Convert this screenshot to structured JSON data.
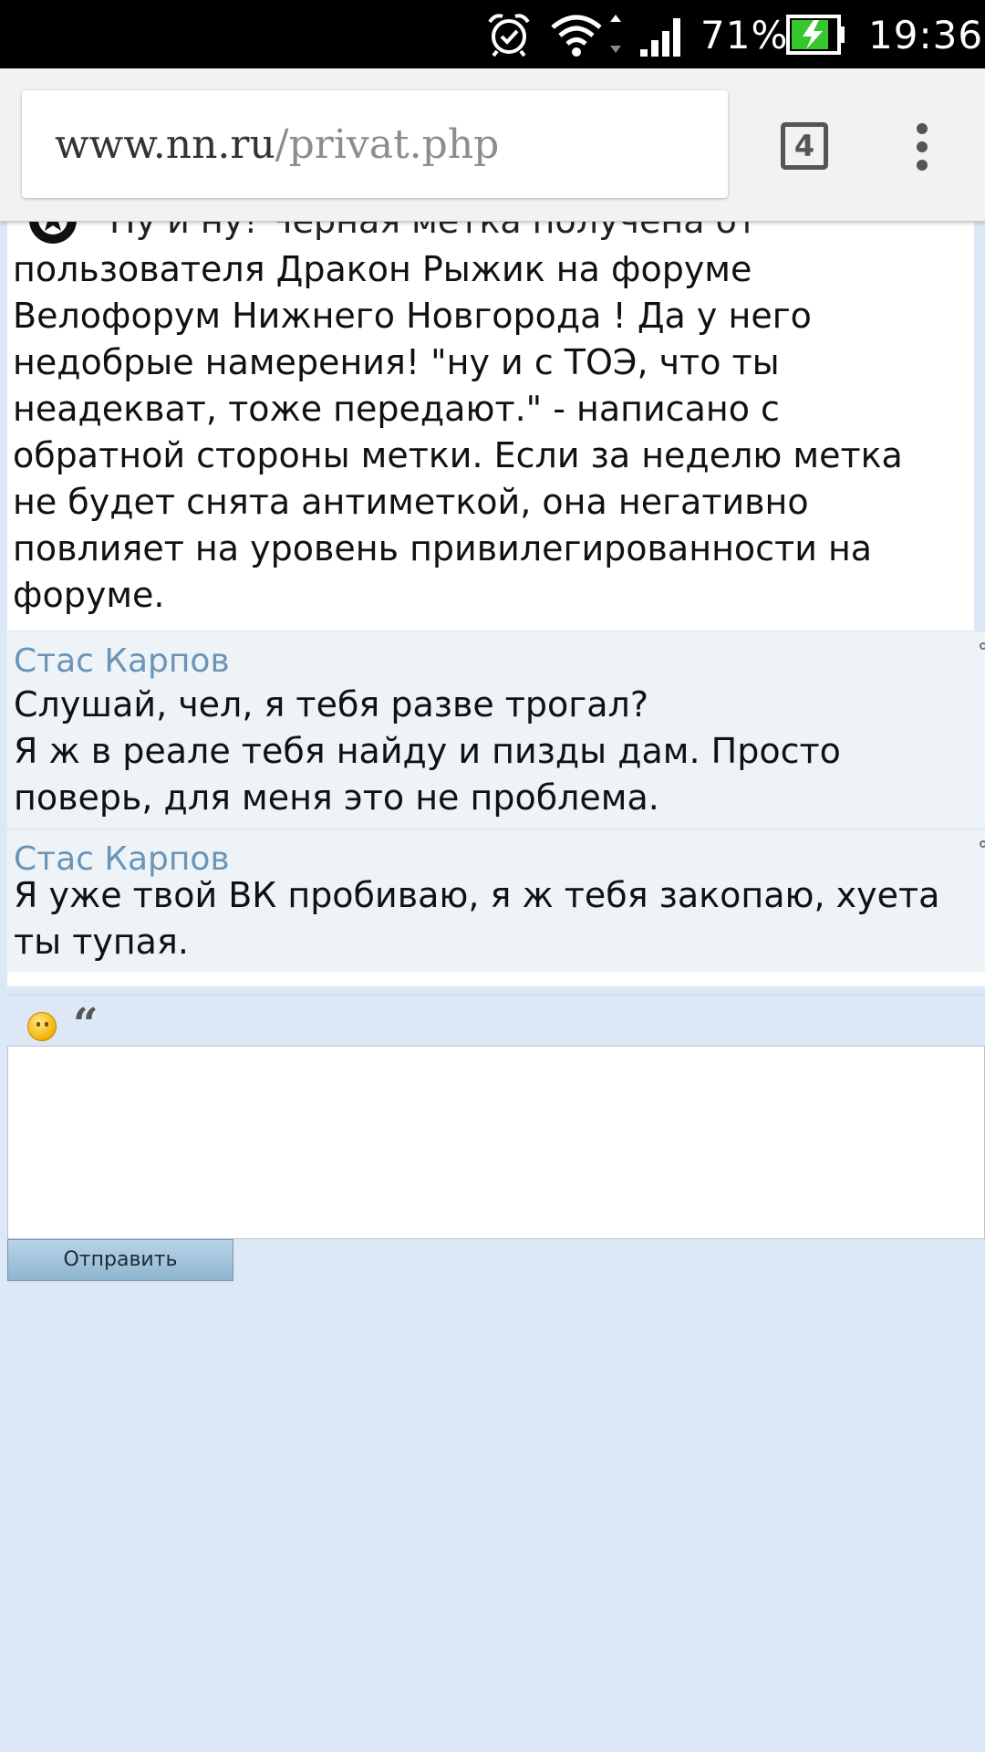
{
  "status_bar": {
    "battery_percent": "71%",
    "time": "19:36"
  },
  "browser": {
    "url_domain": "www.nn.ru",
    "url_path": "/privat.php",
    "tab_count": "4"
  },
  "notice": {
    "cut_line": "Ну и ну! Черная метка получена от",
    "lines": [
      "пользователя Дракон Рыжик на форуме",
      "Велофорум Нижнего Новгорода ! Да у него",
      "недобрые намерения! \"ну и с ТОЭ, что ты",
      "неадекват, тоже передают.\" - написано с",
      "обратной стороны метки. Если за неделю метка",
      "не будет снята антиметкой, она негативно",
      "повлияет на уровень привилегированности на",
      "форуме."
    ]
  },
  "messages": [
    {
      "author": "Стас Карпов",
      "lines": [
        "Слушай, чел, я тебя разве трогал?",
        "Я ж в реале тебя найду и пизды дам. Просто",
        "поверь, для меня это не проблема."
      ]
    },
    {
      "author": "Стас Карпов",
      "lines": [
        "Я уже твой ВК пробиваю, я ж тебя закопаю, хуета",
        "ты тупая."
      ]
    }
  ],
  "reply": {
    "textarea_value": "",
    "send_label": "Отправить",
    "quote_glyph": "“"
  },
  "colors": {
    "author": "#6a95b8",
    "page_background": "#dce8f5",
    "message_background": "#eef3f7"
  }
}
